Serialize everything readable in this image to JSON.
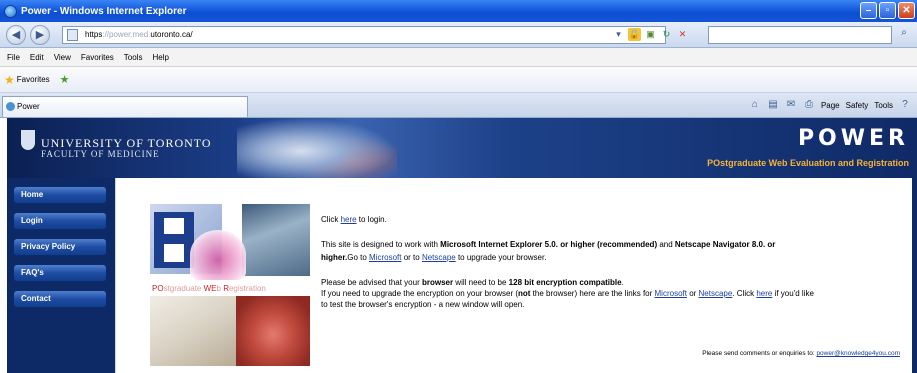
{
  "window": {
    "title": "Power - Windows Internet Explorer"
  },
  "address": {
    "url_prefix": "https",
    "url_host": "://power.med.",
    "url_domain": "utoronto.ca/"
  },
  "menu": [
    "File",
    "Edit",
    "View",
    "Favorites",
    "Tools",
    "Help"
  ],
  "favorites": {
    "label": "Favorites"
  },
  "tab": {
    "label": "Power"
  },
  "command_bar": {
    "page": "Page",
    "safety": "Safety",
    "tools": "Tools"
  },
  "banner": {
    "university": "UNIVERSITY OF TORONTO",
    "faculty": "FACULTY OF MEDICINE",
    "app_name": "POWER",
    "app_subtitle": "POstgraduate Web Evaluation and Registration"
  },
  "sidebar": {
    "items": [
      "Home",
      "Login",
      "Privacy Policy",
      "FAQ's",
      "Contact"
    ]
  },
  "content": {
    "image_title": {
      "part1": "PO",
      "part2": "stgraduate",
      "part3": "WE",
      "part4": "b",
      "part5": "R",
      "part6": "egistration"
    },
    "login": {
      "pre": "Click ",
      "link": "here",
      "post": " to login."
    },
    "browser": {
      "l1_pre": "This site is designed to work with ",
      "l1_b1": "Microsoft Internet Explorer 5.0. or higher (recommended)",
      "l1_mid": " and ",
      "l1_b2": "Netscape Navigator 8.0. or",
      "l2_b": "higher.",
      "l2_text": "Go to ",
      "l2_link1": "Microsoft",
      "l2_mid": " or to ",
      "l2_link2": "Netscape",
      "l2_post": " to upgrade your browser."
    },
    "encryption": {
      "l1_pre": "Please be advised that your ",
      "l1_b1": "browser",
      "l1_mid": " will need to be ",
      "l1_b2": "128 bit encryption compatible",
      "l1_post": ".",
      "l2_pre": "If you need to upgrade the encryption on your browser (",
      "l2_b": "not",
      "l2_mid": " the browser) here are the links for ",
      "l2_link1": "Microsoft",
      "l2_or": " or ",
      "l2_link2": "Netscape",
      "l2_click": ". Click ",
      "l2_link3": "here",
      "l2_post": " if you'd like",
      "l3": "to test the browser's encryption - a new window will open."
    },
    "footer": {
      "text": "Please send comments or enquiries to: ",
      "email": "power@knowledge4you.com"
    }
  },
  "colors": {
    "page_bg": "#0e2a66",
    "accent": "#f4b43a",
    "link": "#1b3fa0"
  }
}
